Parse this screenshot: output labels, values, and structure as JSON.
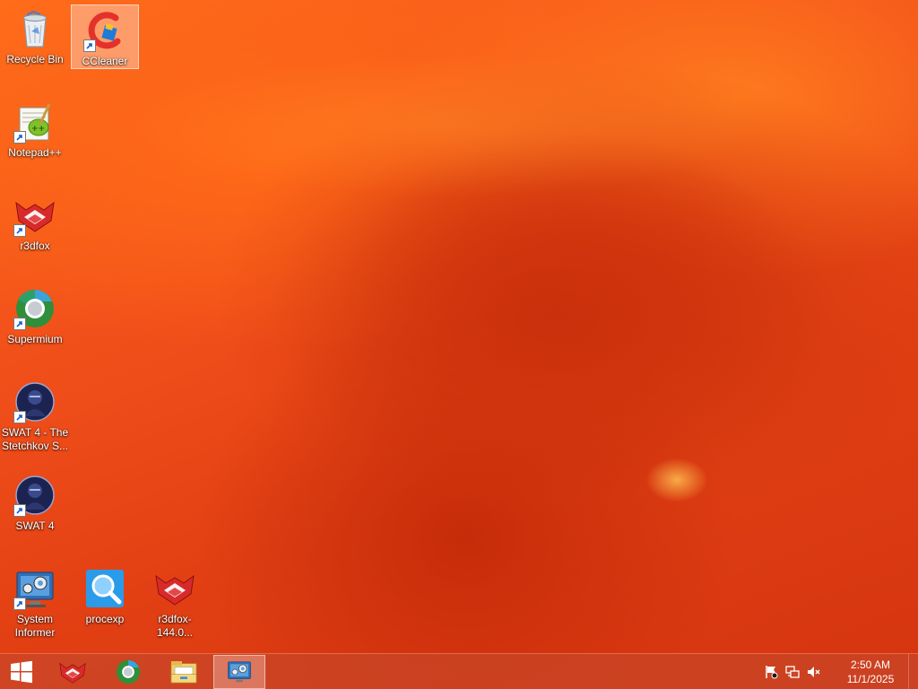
{
  "desktop": {
    "icons": [
      {
        "label": "Recycle Bin",
        "icon": "recycle-bin-icon"
      },
      {
        "label": "CCleaner",
        "icon": "ccleaner-icon"
      },
      {
        "label": "Notepad++",
        "icon": "notepad-plus-plus-icon"
      },
      {
        "label": "r3dfox",
        "icon": "r3dfox-icon"
      },
      {
        "label": "Supermium",
        "icon": "supermium-icon"
      },
      {
        "label": "SWAT 4 - The Stetchkov S...",
        "icon": "swat4-icon"
      },
      {
        "label": "SWAT 4",
        "icon": "swat4-icon"
      },
      {
        "label": "System Informer",
        "icon": "system-informer-icon"
      },
      {
        "label": "procexp",
        "icon": "procexp-icon"
      },
      {
        "label": "r3dfox-144.0...",
        "icon": "r3dfox-icon"
      }
    ],
    "selected_icon": "CCleaner"
  },
  "taskbar": {
    "start_icon": "windows-logo-icon",
    "pinned": [
      {
        "name": "r3dfox",
        "icon": "r3dfox-icon"
      },
      {
        "name": "Supermium",
        "icon": "supermium-icon"
      },
      {
        "name": "File Explorer",
        "icon": "file-explorer-icon"
      },
      {
        "name": "System Informer",
        "icon": "system-informer-icon",
        "active": true
      }
    ],
    "tray": {
      "icons": [
        "action-center-flag-icon",
        "network-icon",
        "volume-muted-icon"
      ],
      "time": "2:50 AM",
      "date": "11/1/2025"
    }
  },
  "colors": {
    "wallpaper_base": "#f2501a",
    "wallpaper_dark": "#c62c0a",
    "taskbar": "#c8462a"
  }
}
